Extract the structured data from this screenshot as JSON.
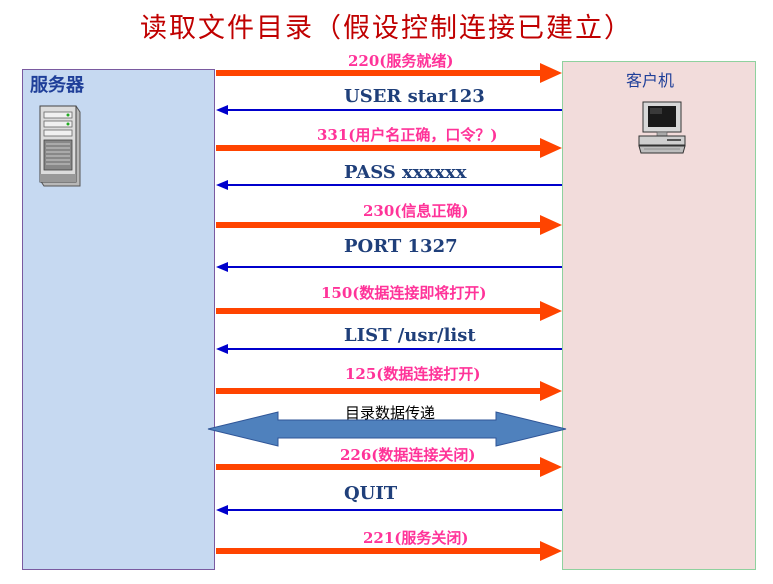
{
  "title": "读取文件目录（假设控制连接已建立）",
  "server": {
    "label": "服务器",
    "icon": "server-tower-icon"
  },
  "client": {
    "label": "客户机",
    "icon": "desktop-computer-icon"
  },
  "colors": {
    "server_to_client": "#ff4400",
    "client_to_server": "#0000cc",
    "server_text": "#ff3399",
    "client_text": "#1f3f7a",
    "transfer_arrow": "#4f81bd"
  },
  "messages": [
    {
      "direction": "server_to_client",
      "text": "220(服务就绪)"
    },
    {
      "direction": "client_to_server",
      "text": "USER star123"
    },
    {
      "direction": "server_to_client",
      "text": "331(用户名正确，口令？)"
    },
    {
      "direction": "client_to_server",
      "text": "PASS xxxxxx"
    },
    {
      "direction": "server_to_client",
      "text": "230(信息正确)"
    },
    {
      "direction": "client_to_server",
      "text": "PORT 1327"
    },
    {
      "direction": "server_to_client",
      "text": "150(数据连接即将打开)"
    },
    {
      "direction": "client_to_server",
      "text": "LIST /usr/list"
    },
    {
      "direction": "server_to_client",
      "text": "125(数据连接打开)"
    },
    {
      "direction": "bidirectional",
      "text": "目录数据传递"
    },
    {
      "direction": "server_to_client",
      "text": "226(数据连接关闭)"
    },
    {
      "direction": "client_to_server",
      "text": "QUIT"
    },
    {
      "direction": "server_to_client",
      "text": "221(服务关闭)"
    }
  ]
}
